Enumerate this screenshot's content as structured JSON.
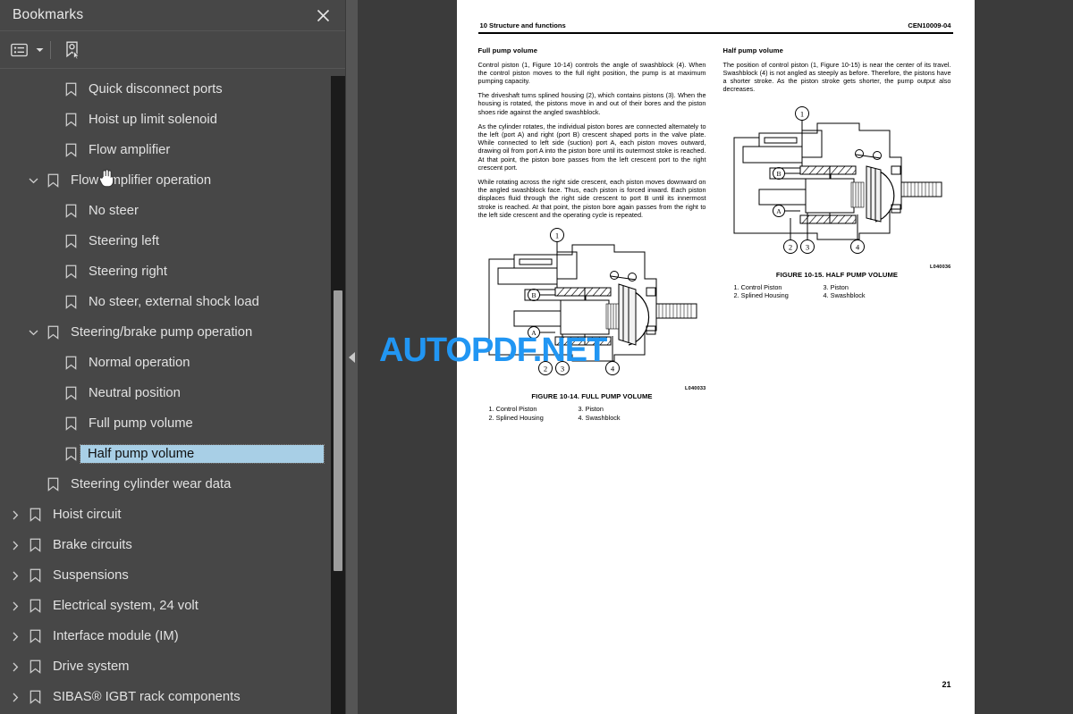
{
  "sidebar": {
    "title": "Bookmarks",
    "close_icon": "close-icon",
    "toolbar": {
      "options_icon": "list-options-icon",
      "caret_icon": "chevron-down-icon",
      "new_bookmark_icon": "new-bookmark-icon"
    },
    "selection_color": "#a8cfe6",
    "background_color": "#474747",
    "items": [
      {
        "label": "Quick disconnect ports",
        "indent": 2,
        "twisty": "none"
      },
      {
        "label": "Hoist up limit solenoid",
        "indent": 2,
        "twisty": "none"
      },
      {
        "label": "Flow amplifier",
        "indent": 2,
        "twisty": "none"
      },
      {
        "label": "Flow amplifier operation",
        "indent": 1,
        "twisty": "down"
      },
      {
        "label": "No steer",
        "indent": 2,
        "twisty": "none"
      },
      {
        "label": "Steering left",
        "indent": 2,
        "twisty": "none"
      },
      {
        "label": "Steering right",
        "indent": 2,
        "twisty": "none"
      },
      {
        "label": "No steer, external shock load",
        "indent": 2,
        "twisty": "none"
      },
      {
        "label": "Steering/brake pump operation",
        "indent": 1,
        "twisty": "down"
      },
      {
        "label": "Normal operation",
        "indent": 2,
        "twisty": "none"
      },
      {
        "label": "Neutral position",
        "indent": 2,
        "twisty": "none"
      },
      {
        "label": "Full pump volume",
        "indent": 2,
        "twisty": "none"
      },
      {
        "label": "Half pump volume",
        "indent": 2,
        "twisty": "none",
        "selected": true
      },
      {
        "label": "Steering cylinder wear data",
        "indent": 1,
        "twisty": "none"
      },
      {
        "label": "Hoist circuit",
        "indent": 0,
        "twisty": "right"
      },
      {
        "label": "Brake circuits",
        "indent": 0,
        "twisty": "right"
      },
      {
        "label": "Suspensions",
        "indent": 0,
        "twisty": "right"
      },
      {
        "label": "Electrical system, 24 volt",
        "indent": 0,
        "twisty": "right"
      },
      {
        "label": "Interface module (IM)",
        "indent": 0,
        "twisty": "right"
      },
      {
        "label": "Drive system",
        "indent": 0,
        "twisty": "right"
      },
      {
        "label": "SIBAS® IGBT rack components",
        "indent": 0,
        "twisty": "right"
      }
    ]
  },
  "splitter": {
    "collapse_icon": "collapse-left-icon"
  },
  "watermark": {
    "text": "AUTOPDF.NET",
    "color": "#2196f3"
  },
  "page": {
    "header_left": "10 Structure and functions",
    "header_right": "CEN10009-04",
    "page_number": "21",
    "left_column": {
      "heading": "Full pump volume",
      "paragraphs": [
        "Control piston (1, Figure 10-14) controls the angle of swashblock (4). When the control piston moves to the full right position, the pump is at maximum pumping capacity.",
        "The driveshaft turns splined housing (2), which contains pistons (3). When the housing is rotated, the pistons move in and out of their bores and the piston shoes ride against the angled swashblock.",
        "As the cylinder rotates, the individual piston bores are connected alternately to the left (port A) and right (port B) crescent shaped ports in the valve plate. While connected to left side (suction) port A, each piston moves outward, drawing oil from port A into the piston bore until its outermost stoke is reached. At that point, the piston bore passes from the left crescent port to the right crescent port.",
        "While rotating across the right side crescent, each piston moves downward on the angled swashblock face. Thus, each piston is forced inward. Each piston displaces fluid through the right side crescent to port B until its innermost stroke is reached. At that point, the piston bore again passes from the right to the left side crescent and the operating cycle is repeated."
      ],
      "figure": {
        "code": "L040033",
        "caption": "FIGURE 10-14. FULL PUMP VOLUME",
        "callouts": [
          "1",
          "2",
          "3",
          "4"
        ],
        "port_labels": [
          "A",
          "B"
        ],
        "legend_left": [
          "1. Control Piston",
          "2. Splined Housing"
        ],
        "legend_right": [
          "3. Piston",
          "4. Swashblock"
        ]
      }
    },
    "right_column": {
      "heading": "Half pump volume",
      "paragraphs": [
        "The position of control piston (1, Figure 10-15) is near the center of its travel. Swashblock (4) is not angled as steeply as before. Therefore, the pistons have a shorter stroke. As the piston stroke gets shorter, the pump output also decreases."
      ],
      "figure": {
        "code": "L040036",
        "caption": "FIGURE 10-15. HALF PUMP VOLUME",
        "callouts": [
          "1",
          "2",
          "3",
          "4"
        ],
        "port_labels": [
          "A",
          "B"
        ],
        "legend_left": [
          "1. Control Piston",
          "2. Splined Housing"
        ],
        "legend_right": [
          "3. Piston",
          "4. Swashblock"
        ]
      }
    }
  }
}
